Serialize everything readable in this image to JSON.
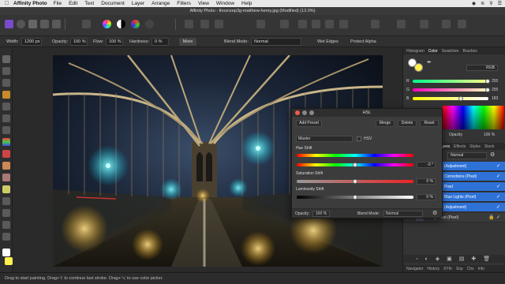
{
  "menubar": {
    "app": "Affinity Photo",
    "items": [
      "File",
      "Edit",
      "Text",
      "Document",
      "Layer",
      "Arrange",
      "Filters",
      "View",
      "Window",
      "Help"
    ]
  },
  "window": {
    "title": "Affinity Photo - thoznzep3g-matthew-henry.jpg (Modified) (13.0%)"
  },
  "context": {
    "width_label": "Width:",
    "width_value": "1200 px",
    "opacity_label": "Opacity:",
    "opacity_value": "100 %",
    "flow_label": "Flow:",
    "flow_value": "100 %",
    "hardness_label": "Hardness:",
    "hardness_value": "0 %",
    "more": "More",
    "blend_label": "Blend Mode:",
    "blend_value": "Normal",
    "wet_edges": "Wet Edges",
    "protect_alpha": "Protect Alpha"
  },
  "right": {
    "top_tabs": [
      "Histogram",
      "Color",
      "Swatches",
      "Brushes"
    ],
    "color_model": "RGB",
    "r_label": "R",
    "r_value": "255",
    "g_label": "G",
    "g_value": "255",
    "b_label": "B",
    "b_value": "183",
    "opacity_label": "Opacity",
    "opacity_value": "100 %",
    "layer_tabs": [
      "Layers",
      "Effects",
      "Styles",
      "Stock"
    ],
    "blend": "Normal",
    "layers": [
      {
        "name": "(Adjustment)"
      },
      {
        "name": "Corrections (Pixel)"
      },
      {
        "name": "Pixel",
        "active": true
      },
      {
        "name": "Blue Lights (Pixel)"
      },
      {
        "name": "(Adjustment)"
      },
      {
        "name": "Background (Pixel)"
      }
    ],
    "bottom_tabs": [
      "Navigator",
      "History",
      "XYth",
      "Snp",
      "Chs",
      "Info"
    ]
  },
  "hsl": {
    "title": "HSL",
    "add_preset": "Add Preset",
    "merge": "Merge",
    "delete": "Delete",
    "reset": "Reset",
    "channel": "Master",
    "hsv_label": "HSV",
    "hue_label": "Hue Shift",
    "hue_value": "-0 °",
    "sat_label": "Saturation Shift",
    "sat_value": "0 %",
    "lum_label": "Luminosity Shift",
    "lum_value": "0 %",
    "opacity_label": "Opacity:",
    "opacity_value": "100 %",
    "blend_label": "Blend Mode:",
    "blend_value": "Normal"
  },
  "status": "Drag to start painting. Drag+⇧ to continue last stroke. Drag+⌥ to use color picker.",
  "colors": {
    "accent": "#2e72d8",
    "bg": "#2b2b2b",
    "panel": "#343434"
  }
}
